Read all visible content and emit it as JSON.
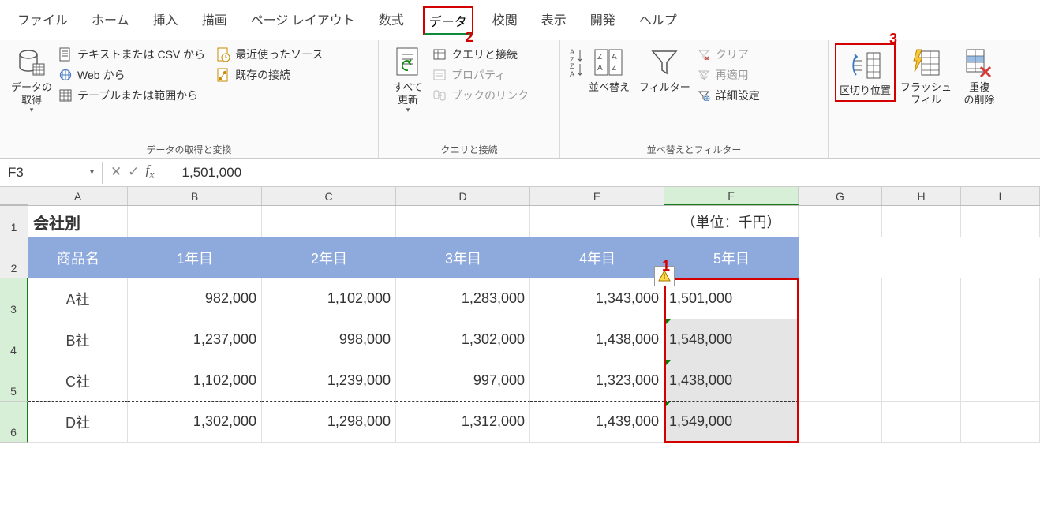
{
  "tabs": {
    "file": "ファイル",
    "home": "ホーム",
    "insert": "挿入",
    "draw": "描画",
    "page_layout": "ページ レイアウト",
    "formulas": "数式",
    "data": "データ",
    "review": "校閲",
    "view": "表示",
    "developer": "開発",
    "help": "ヘルプ"
  },
  "annotations": {
    "one": "1",
    "two": "2",
    "three": "3"
  },
  "ribbon": {
    "g1": {
      "get_data": "データの\n取得",
      "items": {
        "csv": "テキストまたは CSV から",
        "web": "Web から",
        "table": "テーブルまたは範囲から",
        "recent": "最近使ったソース",
        "existing": "既存の接続"
      },
      "label": "データの取得と変換"
    },
    "g2": {
      "refresh": "すべて\n更新",
      "items": {
        "queries": "クエリと接続",
        "properties": "プロパティ",
        "links": "ブックのリンク"
      },
      "label": "クエリと接続"
    },
    "g3": {
      "sort": "並べ替え",
      "filter": "フィルター",
      "clear": "クリア",
      "reapply": "再適用",
      "advanced": "詳細設定",
      "label": "並べ替えとフィルター"
    },
    "g4": {
      "text_cols": "区切り位置",
      "flash": "フラッシュ\nフィル",
      "dup": "重複\nの削除"
    }
  },
  "formula_bar": {
    "name_box": "F3",
    "value": "1,501,000"
  },
  "cols": [
    "A",
    "B",
    "C",
    "D",
    "E",
    "F",
    "G",
    "H",
    "I"
  ],
  "rownums": [
    "1",
    "2",
    "3",
    "4",
    "5",
    "6"
  ],
  "sheet": {
    "title": "会社別",
    "unit": "（単位：千円）",
    "headers": [
      "商品名",
      "1年目",
      "2年目",
      "3年目",
      "4年目",
      "5年目"
    ],
    "rows": [
      {
        "name": "A社",
        "v": [
          "982,000",
          "1,102,000",
          "1,283,000",
          "1,343,000",
          "1,501,000"
        ]
      },
      {
        "name": "B社",
        "v": [
          "1,237,000",
          "998,000",
          "1,302,000",
          "1,438,000",
          "1,548,000"
        ]
      },
      {
        "name": "C社",
        "v": [
          "1,102,000",
          "1,239,000",
          "997,000",
          "1,323,000",
          "1,438,000"
        ]
      },
      {
        "name": "D社",
        "v": [
          "1,302,000",
          "1,298,000",
          "1,312,000",
          "1,439,000",
          "1,549,000"
        ]
      }
    ]
  }
}
